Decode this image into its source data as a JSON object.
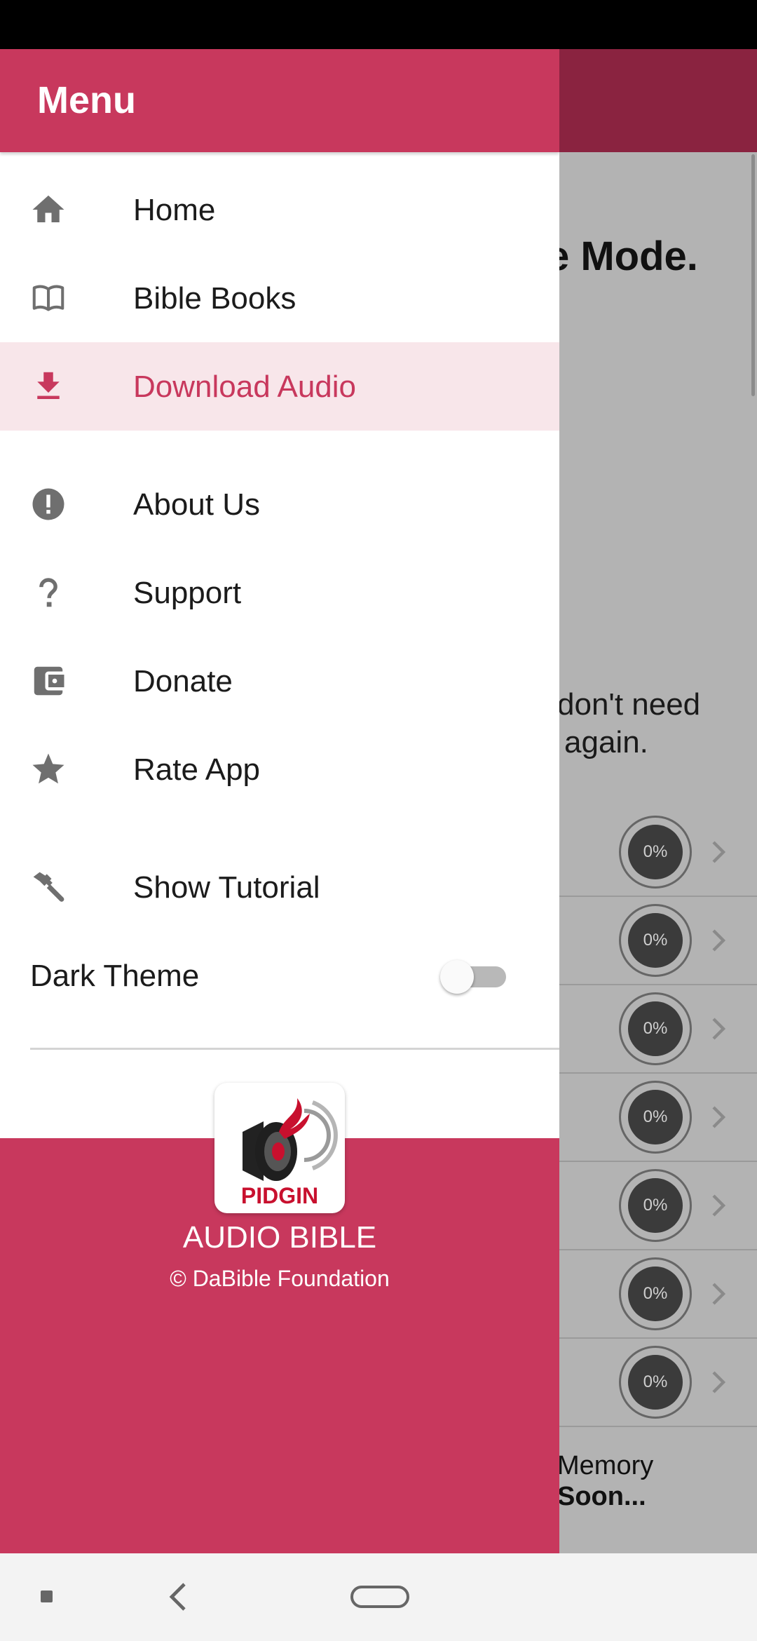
{
  "drawer": {
    "title": "Menu",
    "items": [
      {
        "label": "Home",
        "icon": "home-icon"
      },
      {
        "label": "Bible Books",
        "icon": "book-icon"
      },
      {
        "label": "Download Audio",
        "icon": "download-icon",
        "active": true
      },
      {
        "label": "About Us",
        "icon": "info-alert-icon"
      },
      {
        "label": "Support",
        "icon": "question-icon"
      },
      {
        "label": "Donate",
        "icon": "wallet-icon"
      },
      {
        "label": "Rate App",
        "icon": "star-icon"
      },
      {
        "label": "Show Tutorial",
        "icon": "hammer-icon"
      }
    ],
    "dark_theme": {
      "label": "Dark Theme",
      "enabled": false
    },
    "footer": {
      "logo_text": "PIDGIN",
      "title": "AUDIO BIBLE",
      "copyright": "© DaBible Foundation"
    }
  },
  "background_app": {
    "heading_fragment": "e Mode.",
    "paragraph_fragment_line1": "don't need",
    "paragraph_fragment_line2": "again.",
    "progress_rows": [
      "0%",
      "0%",
      "0%",
      "0%",
      "0%",
      "0%",
      "0%"
    ],
    "memory_line1": "Memory",
    "memory_line2": "Soon..."
  },
  "colors": {
    "accent": "#c8385d",
    "accent_dark": "#8a2340",
    "active_bg": "#f8e6ea",
    "scrim": "#b3b3b3"
  }
}
